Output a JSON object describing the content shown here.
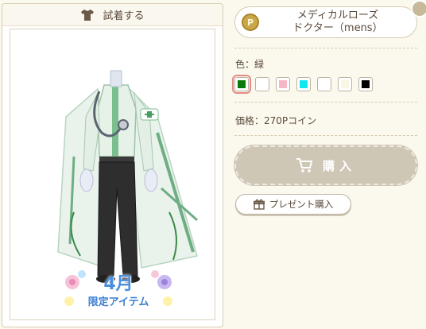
{
  "tryon": {
    "title": "試着する"
  },
  "badge": {
    "month": "4月",
    "limited": "限定アイテム"
  },
  "item": {
    "name_line1": "メディカルローズ",
    "name_line2": "ドクター（mens）",
    "coin_symbol": "P"
  },
  "color": {
    "label": "色：緑",
    "swatches": [
      {
        "name": "緑",
        "hex": "#0a7a0a",
        "selected": true
      },
      {
        "name": "white",
        "hex": "#ffffff",
        "selected": false
      },
      {
        "name": "pink",
        "hex": "#f7b6c6",
        "selected": false
      },
      {
        "name": "cyan",
        "hex": "#14e6f0",
        "selected": false
      },
      {
        "name": "white2",
        "hex": "#ffffff",
        "selected": false
      },
      {
        "name": "cream",
        "hex": "#fbf6e4",
        "selected": false
      },
      {
        "name": "black",
        "hex": "#000000",
        "selected": false
      }
    ]
  },
  "price": {
    "label": "価格：270Pコイン"
  },
  "buttons": {
    "buy": "購入",
    "gift": "プレゼント購入"
  }
}
